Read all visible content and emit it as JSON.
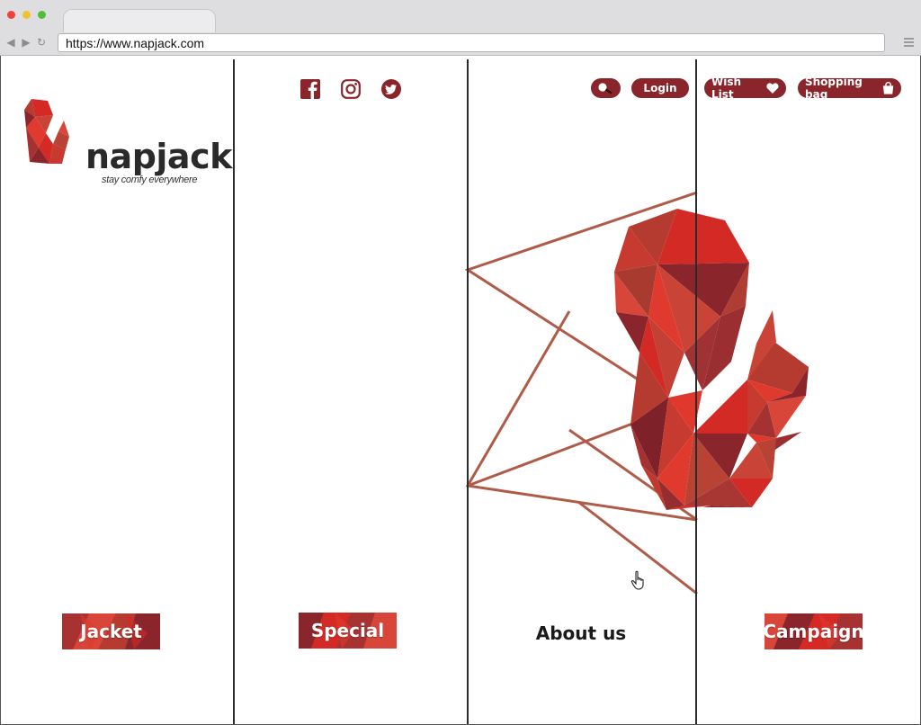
{
  "browser": {
    "url": "https://www.napjack.com"
  },
  "brand": {
    "name": "napjack",
    "tagline": "stay comfy everywhere",
    "accent": "#8a252c",
    "red": "#d42a26",
    "outline": "#b05a48"
  },
  "social": [
    {
      "icon": "facebook-icon"
    },
    {
      "icon": "instagram-icon"
    },
    {
      "icon": "twitter-icon"
    }
  ],
  "header": {
    "search_icon": "search-icon",
    "login_label": "Login",
    "wishlist_label": "Wish List",
    "wishlist_icon": "heart-icon",
    "bag_label": "Shopping bag",
    "bag_icon": "shopping-bag-icon"
  },
  "categories": {
    "jacket": "Jacket",
    "special": "Special",
    "about": "About us",
    "campaign": "Campaign"
  }
}
